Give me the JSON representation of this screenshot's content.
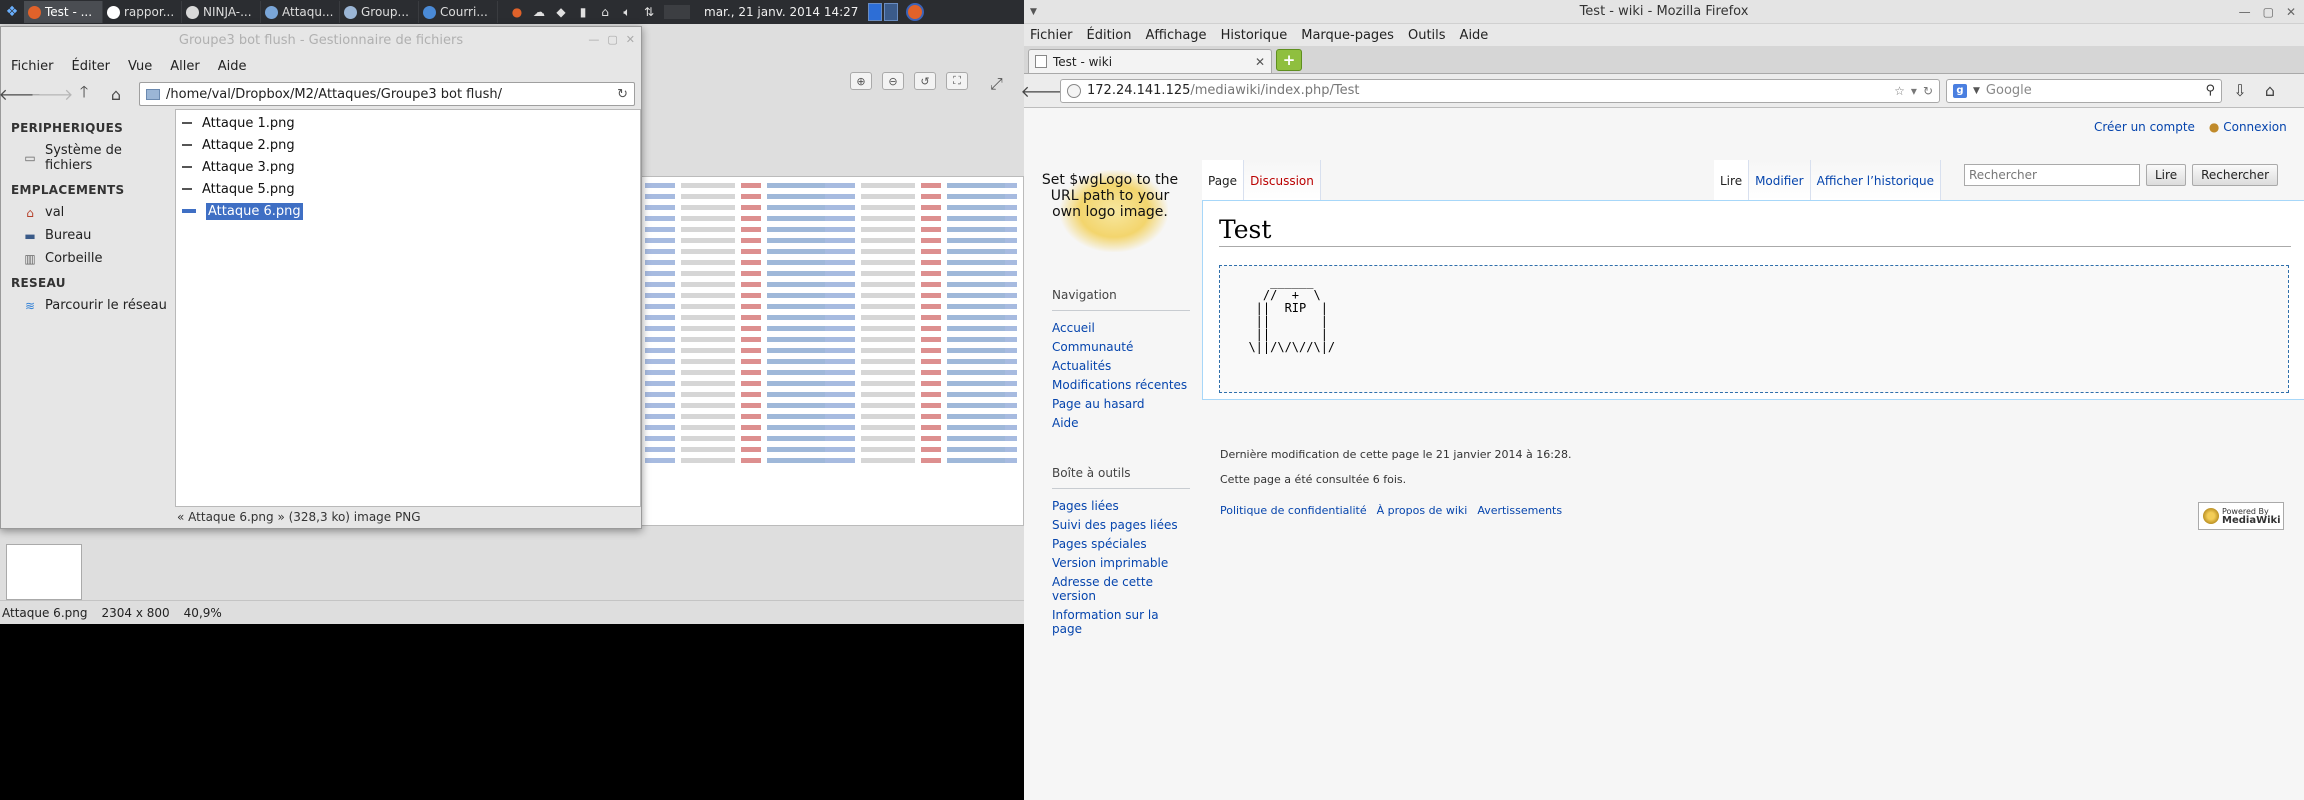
{
  "panel": {
    "tasks": [
      {
        "label": "Test - ...",
        "color": "#e0622a",
        "active": true
      },
      {
        "label": "rappor...",
        "color": "#ffffff",
        "active": false
      },
      {
        "label": "NINJA-...",
        "color": "#d9d9d9",
        "active": false
      },
      {
        "label": "Attaqu...",
        "color": "#7aa6d8",
        "active": false
      },
      {
        "label": "Group...",
        "color": "#9bb6d6",
        "active": false
      },
      {
        "label": "Courri...",
        "color": "#4a8ad6",
        "active": false
      }
    ],
    "clock": "mar., 21 janv. 2014 14:27"
  },
  "viewer": {
    "status_name": "Attaque 6.png",
    "status_dims": "2304 x 800",
    "status_zoom": "40,9%"
  },
  "file_manager": {
    "title": "Groupe3 bot flush - Gestionnaire de fichiers",
    "menu": [
      "Fichier",
      "Éditer",
      "Vue",
      "Aller",
      "Aide"
    ],
    "path": "/home/val/Dropbox/M2/Attaques/Groupe3 bot flush/",
    "sidebar": {
      "peripheriques": "PERIPHERIQUES",
      "filesystem": "Système de fichiers",
      "emplacements": "EMPLACEMENTS",
      "places": [
        "val",
        "Bureau",
        "Corbeille"
      ],
      "reseau": "RESEAU",
      "browse_network": "Parcourir le réseau"
    },
    "files": [
      "Attaque 1.png",
      "Attaque 2.png",
      "Attaque 3.png",
      "Attaque 5.png",
      "Attaque 6.png"
    ],
    "selected_file": "Attaque 6.png",
    "status": "« Attaque 6.png » (328,3 ko) image PNG"
  },
  "firefox": {
    "title": "Test - wiki - Mozilla Firefox",
    "menu": [
      "Fichier",
      "Édition",
      "Affichage",
      "Historique",
      "Marque-pages",
      "Outils",
      "Aide"
    ],
    "tab_label": "Test - wiki",
    "url_host": "172.24.141.125",
    "url_path": "/mediawiki/index.php/Test",
    "search_placeholder": "Google"
  },
  "wiki": {
    "personal": {
      "create_account": "Créer un compte",
      "login": "Connexion"
    },
    "logo_text": "Set $wgLogo to the URL path to your own logo image.",
    "tabs": {
      "page": "Page",
      "discussion": "Discussion",
      "read": "Lire",
      "edit": "Modifier",
      "history": "Afficher l’historique"
    },
    "search": {
      "placeholder": "Rechercher",
      "go": "Lire",
      "search": "Rechercher"
    },
    "heading": "Test",
    "ascii_art": "     ______\n    //  +  \\\n   ||  RIP  |\n   ||       |\n   ||       |\n  \\||/\\/\\//\\|/",
    "nav": {
      "title": "Navigation",
      "items": [
        "Accueil",
        "Communauté",
        "Actualités",
        "Modifications récentes",
        "Page au hasard",
        "Aide"
      ]
    },
    "tools": {
      "title": "Boîte à outils",
      "items": [
        "Pages liées",
        "Suivi des pages liées",
        "Pages spéciales",
        "Version imprimable",
        "Adresse de cette version",
        "Information sur la page"
      ]
    },
    "footer": {
      "last_modified": "Dernière modification de cette page le 21 janvier 2014 à 16:28.",
      "views": "Cette page a été consultée 6 fois.",
      "links": [
        "Politique de confidentialité",
        "À propos de wiki",
        "Avertissements"
      ],
      "powered_1": "Powered By",
      "powered_2": "MediaWiki"
    }
  }
}
